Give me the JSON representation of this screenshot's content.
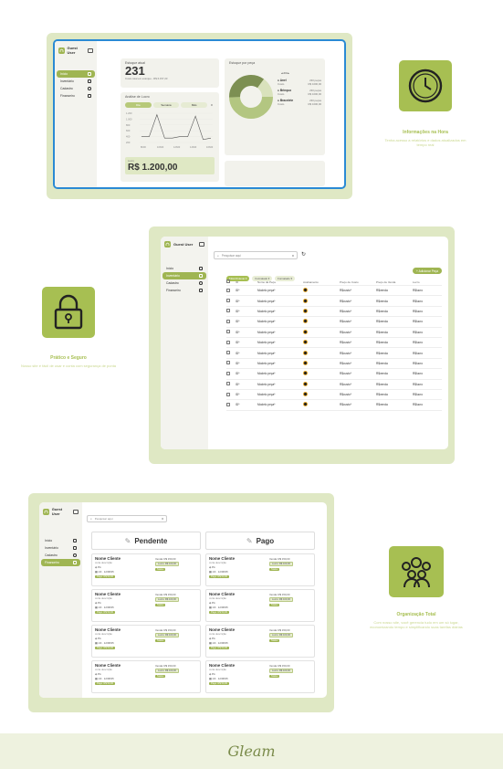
{
  "app": {
    "user": "Guest User",
    "footer_brand": "Gleam"
  },
  "nav": [
    "Início",
    "Inventário",
    "Cadastro",
    "Financeiro"
  ],
  "dashboard": {
    "estoque_label": "Estoque atual",
    "estoque_value": "231",
    "estoque_sub": "Custo total em estoque - R$ 6.157,23",
    "estoque_peca_label": "Estoque por peça",
    "pie_nav": "2/4",
    "legend": [
      {
        "name": "Anel",
        "qty": "230 peças",
        "cost_label": "Custo",
        "cost": "R$ 1000,00"
      },
      {
        "name": "Brinquo",
        "qty": "230 peças",
        "cost_label": "Custo",
        "cost": "R$ 1000,00"
      },
      {
        "name": "Bracelete",
        "qty": "230 peças",
        "cost_label": "Custo",
        "cost": "R$ 1000,00"
      }
    ],
    "analise_label": "Análise de Lucro",
    "tabs": [
      "Dia",
      "Semana",
      "Mês"
    ],
    "y_ticks": [
      "1.200",
      "1.000",
      "800",
      "600",
      "400",
      "200"
    ],
    "x_ticks": [
      "8h00",
      "10h00",
      "12h00",
      "14h00",
      "16h00"
    ],
    "lucro_label": "Lucro",
    "lucro_value": "R$ 1.200,00"
  },
  "chart_data": {
    "type": "line",
    "series": [
      {
        "values": [
          20,
          20,
          95,
          15,
          15,
          20,
          20,
          90,
          10,
          15
        ]
      }
    ],
    "ylim": [
      0,
      1200
    ]
  },
  "features": [
    {
      "title": "Informações na Hora",
      "desc": "Tenha acesso a relatórios e dados atualizados em tempo real"
    },
    {
      "title": "Prático e Seguro",
      "desc": "Nosso site é fácil de usar e conta com segurança de ponta"
    },
    {
      "title": "Organização Total",
      "desc": "Com nosso site, você gerencia tudo em um só lugar, economizando tempo e simplificando suas tarefas diárias"
    }
  ],
  "inventory": {
    "search_placeholder": "Pesquisar aqui",
    "filters": [
      "Filtro/Ordenar ▾",
      "Formatado ▾",
      "Formatado ▾"
    ],
    "add_button": "+ Adicionar Peça",
    "headers": [
      "ID",
      "Nome da Peça",
      "Acabamento",
      "Preço de Custo",
      "Preço de Venda",
      "Lucro"
    ],
    "row": {
      "id": "ID*",
      "nome": "Modelo peça*",
      "custo": "R$custo*",
      "venda": "R$venda",
      "lucro": "R$lucro"
    },
    "rows": 12
  },
  "orders": {
    "search_placeholder": "Pesquisar aqui",
    "col_pendente": "Pendente",
    "col_pago": "Pago",
    "card": {
      "nome": "Nome Cliente",
      "desc": "curta descrição",
      "pix": "Pix",
      "parcelas": "1/3 · 12/08/25",
      "pago": "Pago: R$ 50,00",
      "venda": "Venda: R$ 150,00",
      "lucro": "Lucro: R$ 100,00",
      "status": "Status"
    }
  }
}
